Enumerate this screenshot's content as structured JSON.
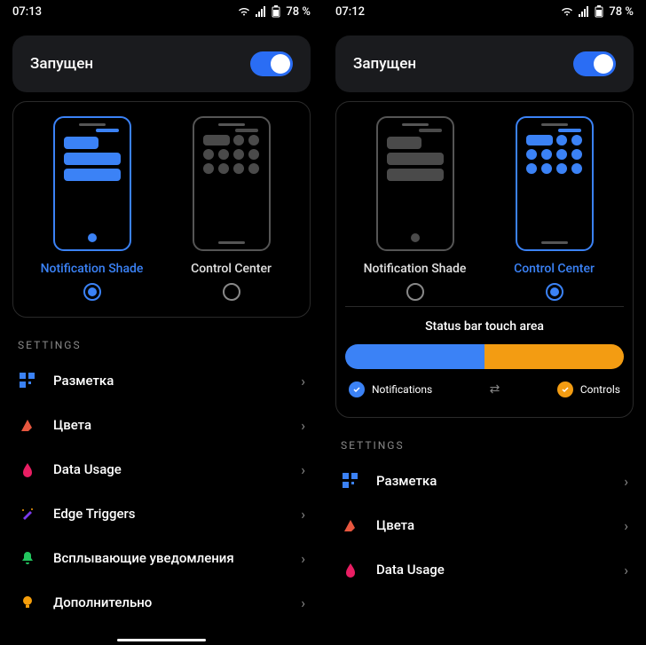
{
  "left": {
    "status": {
      "time": "07:13",
      "battery": "78 %"
    },
    "running": {
      "title": "Запущен",
      "enabled": true
    },
    "modes": {
      "a": {
        "label": "Notification Shade",
        "selected": true
      },
      "b": {
        "label": "Control Center",
        "selected": false
      }
    },
    "settings_header": "SETTINGS",
    "settings": [
      {
        "label": "Разметка"
      },
      {
        "label": "Цвета"
      },
      {
        "label": "Data Usage"
      },
      {
        "label": "Edge Triggers"
      },
      {
        "label": "Всплывающие уведомления"
      },
      {
        "label": "Дополнительно"
      }
    ]
  },
  "right": {
    "status": {
      "time": "07:12",
      "battery": "78 %"
    },
    "running": {
      "title": "Запущен",
      "enabled": true
    },
    "modes": {
      "a": {
        "label": "Notification Shade",
        "selected": false
      },
      "b": {
        "label": "Control Center",
        "selected": true
      }
    },
    "touch": {
      "title": "Status bar touch area",
      "left_label": "Notifications",
      "right_label": "Controls"
    },
    "settings_header": "SETTINGS",
    "settings": [
      {
        "label": "Разметка"
      },
      {
        "label": "Цвета"
      },
      {
        "label": "Data Usage"
      }
    ]
  }
}
